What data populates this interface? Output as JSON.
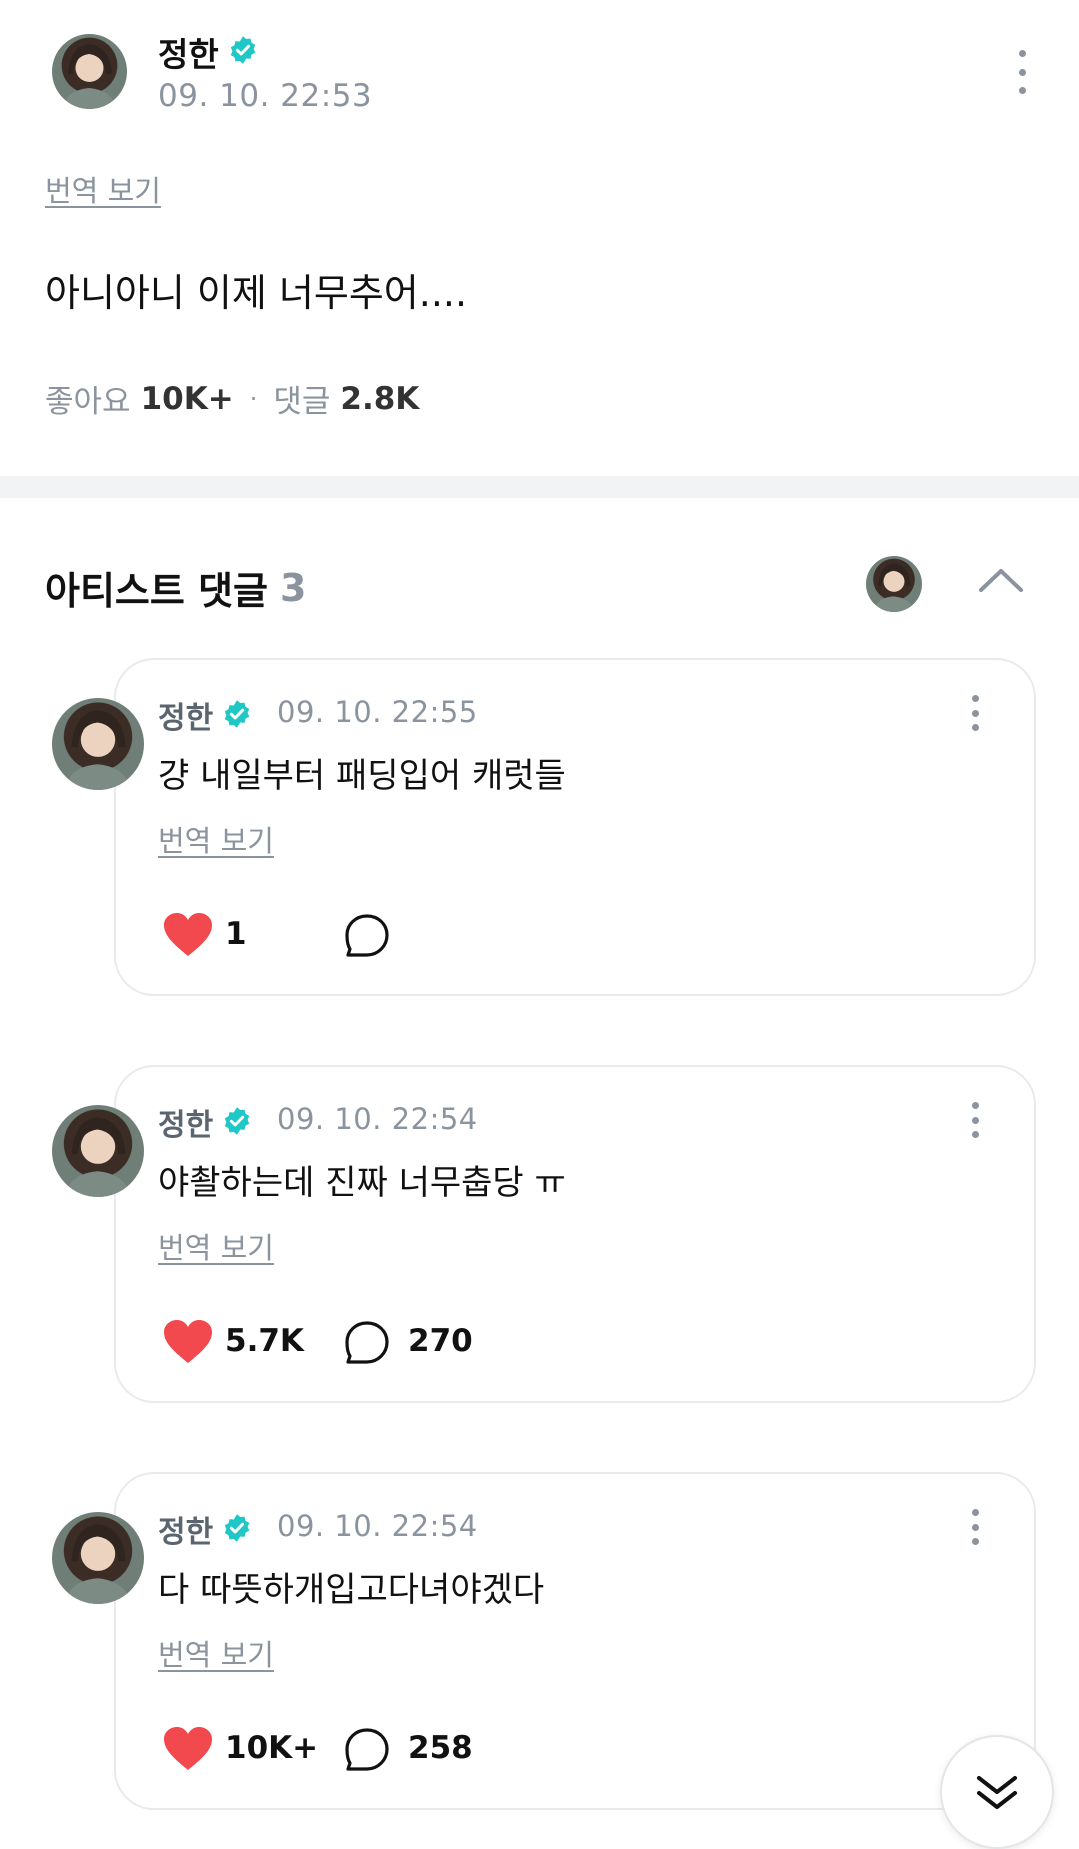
{
  "post": {
    "author": "정한",
    "verified": true,
    "timestamp": "09. 10. 22:53",
    "translate_label": "번역 보기",
    "body": "아니아니 이제 너무추어....",
    "likes_label": "좋아요",
    "likes_count": "10K+",
    "separator": "·",
    "comments_label": "댓글",
    "comments_count": "2.8K"
  },
  "artist_comments": {
    "title": "아티스트 댓글",
    "count": "3",
    "collapse_icon": "chevron-up-icon"
  },
  "comments": [
    {
      "author": "정한",
      "timestamp": "09. 10. 22:55",
      "text": "걍 내일부터 패딩입어 캐럿들",
      "translate_label": "번역 보기",
      "likes": "1",
      "replies": ""
    },
    {
      "author": "정한",
      "timestamp": "09. 10. 22:54",
      "text": "야촬하는데 진짜 너무춥당 ㅠ",
      "translate_label": "번역 보기",
      "likes": "5.7K",
      "replies": "270"
    },
    {
      "author": "정한",
      "timestamp": "09. 10. 22:54",
      "text": "다 따뜻하개입고다녀야겠다",
      "translate_label": "번역 보기",
      "likes": "10K+",
      "replies": "258"
    }
  ],
  "colors": {
    "verified": "#1fc7c7",
    "heart": "#f2494f",
    "muted_text": "#8b949e",
    "divider": "#f2f3f5"
  },
  "scroll_down_icon": "double-chevron-down-icon"
}
